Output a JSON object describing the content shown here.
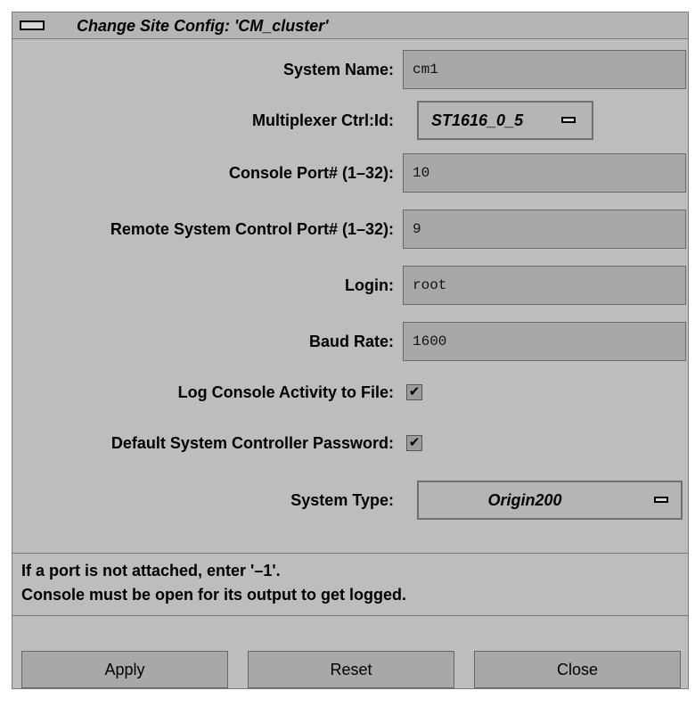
{
  "window": {
    "title": "Change Site Config: 'CM_cluster'"
  },
  "form": {
    "system_name": {
      "label": "System Name:",
      "value": "cm1"
    },
    "multiplexer": {
      "label": "Multiplexer Ctrl:Id:",
      "value": "ST1616_0_5"
    },
    "console_port": {
      "label": "Console Port# (1–32):",
      "value": "10"
    },
    "remote_port": {
      "label": "Remote System Control Port# (1–32):",
      "value": "9"
    },
    "login": {
      "label": "Login:",
      "value": "root"
    },
    "baud_rate": {
      "label": "Baud Rate:",
      "value": "1600"
    },
    "log_console": {
      "label": "Log Console Activity to File:",
      "checked": true
    },
    "default_password": {
      "label": "Default System Controller Password:",
      "checked": true
    },
    "system_type": {
      "label": "System Type:",
      "value": "Origin200"
    }
  },
  "messages": {
    "line1": "If a port is not attached, enter '–1'.",
    "line2": "Console must be open for its output to get logged."
  },
  "buttons": {
    "apply": "Apply",
    "reset": "Reset",
    "close": "Close"
  },
  "icons": {
    "checkmark": "✔"
  }
}
